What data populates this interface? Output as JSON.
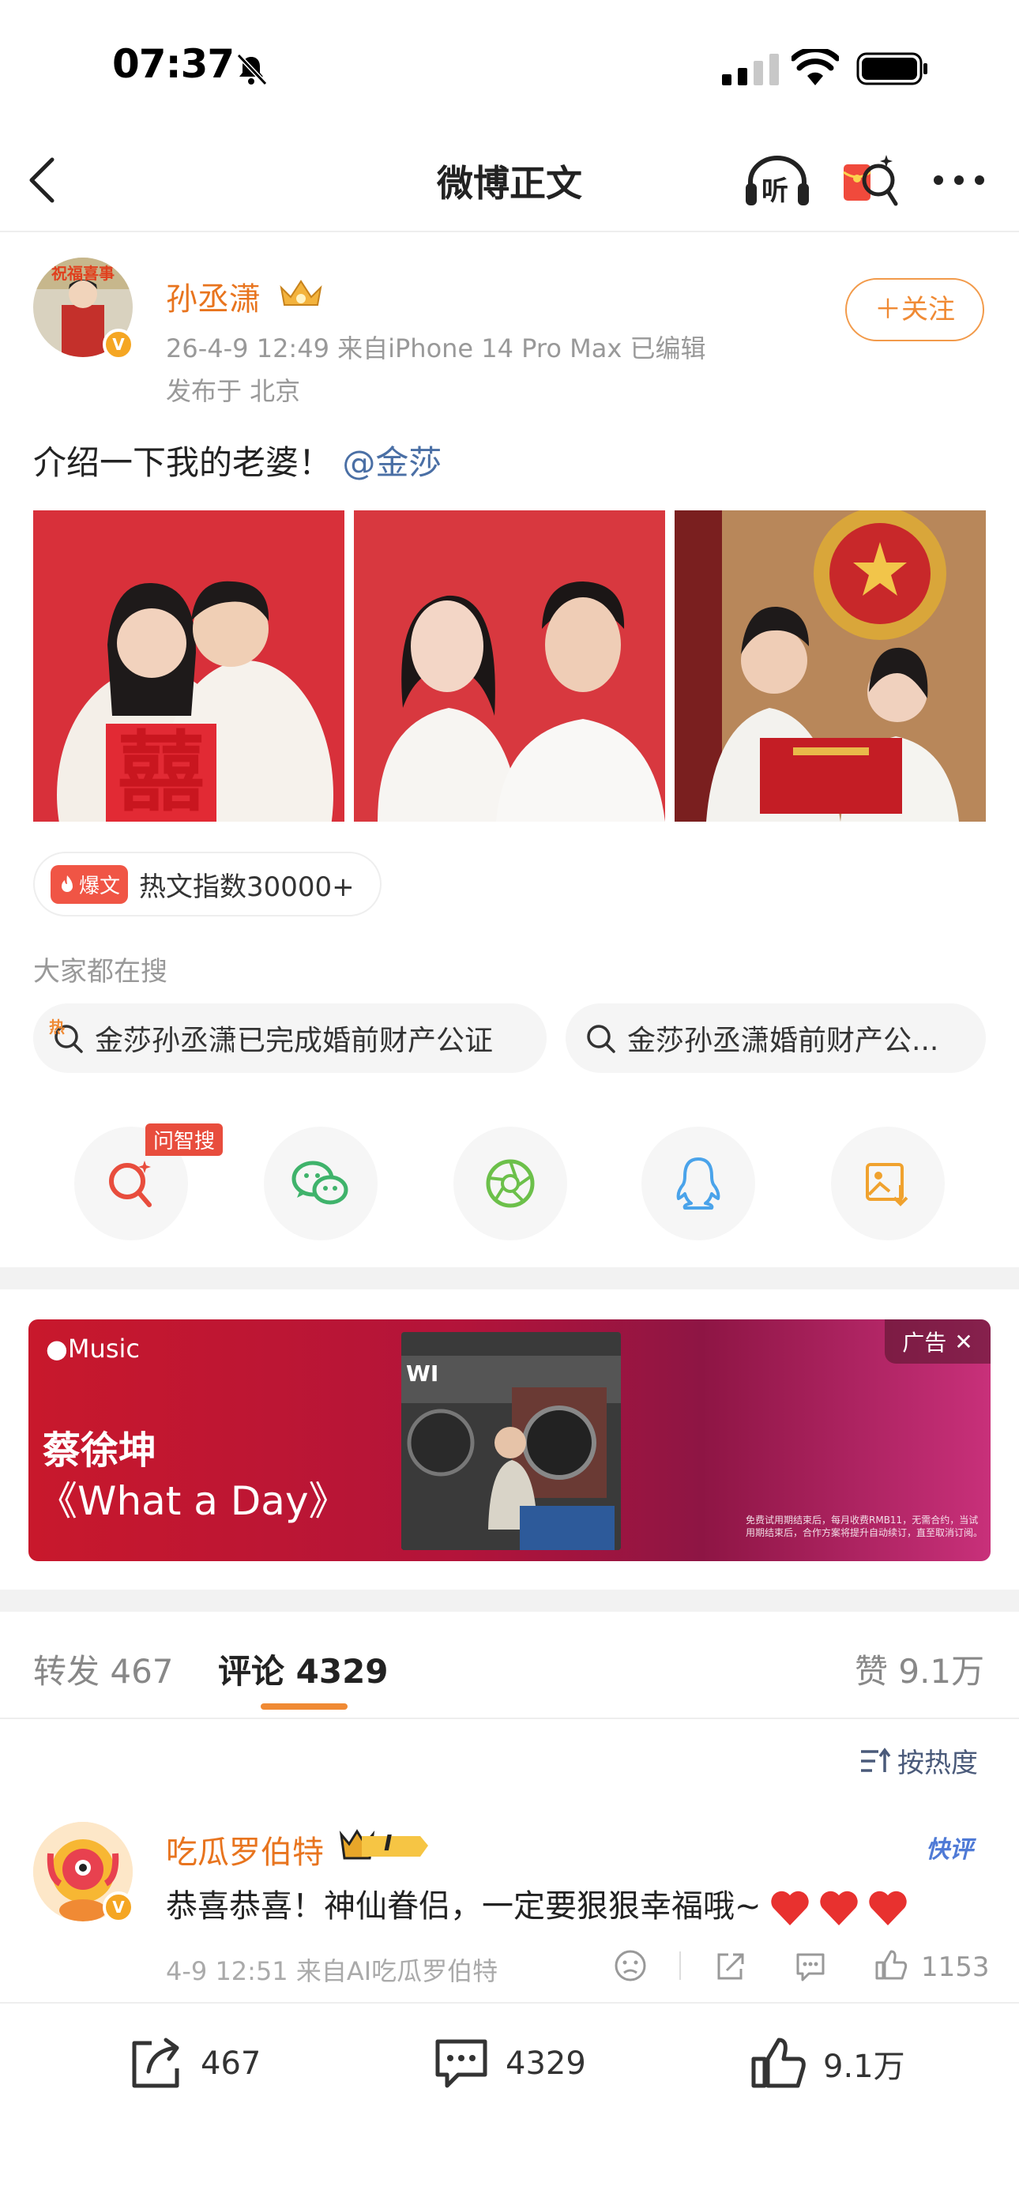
{
  "status_bar": {
    "time": "07:37"
  },
  "nav": {
    "title": "微博正文",
    "listen_label": "听"
  },
  "post": {
    "author": "孙丞潇",
    "meta": "26-4-9 12:49  来自iPhone 14 Pro Max  已编辑",
    "location": "发布于 北京",
    "follow_label": "＋关注",
    "text": "介绍一下我的老婆！",
    "mention": "@金莎",
    "avatar_banner_text": "祝福喜事",
    "hot_badge": "爆文",
    "hot_text": "热文指数30000+"
  },
  "search": {
    "title": "大家都在搜",
    "hot_mark": "热",
    "chips": [
      "金莎孙丞潇已完成婚前财产公证",
      "金莎孙丞潇婚前财产公..."
    ]
  },
  "share": {
    "wzs_tag": "问智搜"
  },
  "ad": {
    "brand": "Music",
    "artist": "蔡徐坤",
    "song": "《What a Day》",
    "tag": "广告",
    "fine_print": "免费试用期结束后，每月收费RMB11，无需合约，当试用期结束后，合作方案将提升自动续订，直至取消订阅。"
  },
  "tabs": {
    "repost": "转发 467",
    "comment": "评论 4329",
    "like": "赞 9.1万"
  },
  "sort_label": "按热度",
  "comment": {
    "name": "吃瓜罗伯特",
    "vip_label": "I",
    "kuaiping": "快评",
    "text": "恭喜恭喜！神仙眷侣，一定要狠狠幸福哦~",
    "meta": "4-9 12:51 来自AI吃瓜罗伯特",
    "likes": "1153"
  },
  "bottom_bar": {
    "repost": "467",
    "comment": "4329",
    "like": "9.1万"
  },
  "colors": {
    "accent": "#f08a34",
    "name": "#e8741e",
    "link": "#4a6fa5",
    "hot_red": "#f05545"
  }
}
